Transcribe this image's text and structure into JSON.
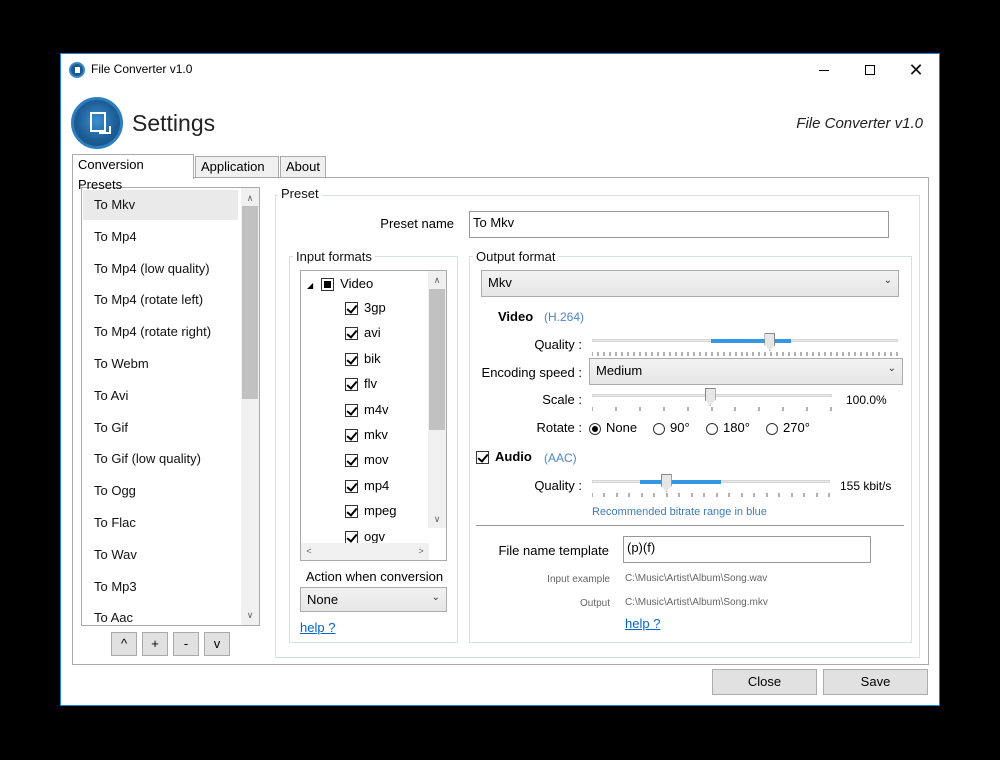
{
  "window": {
    "title": "File Converter v1.0",
    "header_title": "Settings",
    "header_right": "File Converter v1.0"
  },
  "titlebar_buttons": {
    "close_glyph": "✕"
  },
  "tabs": [
    {
      "label": "Conversion Presets",
      "active": true
    },
    {
      "label": "Application",
      "active": false
    },
    {
      "label": "About",
      "active": false
    }
  ],
  "presets": {
    "items": [
      "To Mkv",
      "To Mp4",
      "To Mp4 (low quality)",
      "To Mp4 (rotate left)",
      "To Mp4 (rotate right)",
      "To Webm",
      "To Avi",
      "To Gif",
      "To Gif (low quality)",
      "To Ogg",
      "To Flac",
      "To Wav",
      "To Mp3",
      "To Aac"
    ],
    "selected_index": 0,
    "scroll_fraction": 0.0,
    "buttons": {
      "up": "^",
      "add": "+",
      "remove": "-",
      "down": "v"
    }
  },
  "preset": {
    "group_label": "Preset",
    "name_label": "Preset name",
    "name_value": "To Mkv"
  },
  "input_formats": {
    "group_label": "Input formats",
    "tree_root": "Video",
    "tree_expander": "◢",
    "formats": [
      {
        "name": "3gp",
        "checked": true
      },
      {
        "name": "avi",
        "checked": true
      },
      {
        "name": "bik",
        "checked": true
      },
      {
        "name": "flv",
        "checked": true
      },
      {
        "name": "m4v",
        "checked": true
      },
      {
        "name": "mkv",
        "checked": true
      },
      {
        "name": "mov",
        "checked": true
      },
      {
        "name": "mp4",
        "checked": true
      },
      {
        "name": "mpeg",
        "checked": true
      },
      {
        "name": "ogv",
        "checked": true
      }
    ],
    "action_label": "Action when conversion",
    "action_value": "None",
    "help_link": "help ?"
  },
  "output": {
    "group_label": "Output format",
    "format_value": "Mkv",
    "video": {
      "label": "Video",
      "codec": "(H.264)",
      "quality_label": "Quality :",
      "quality_fraction": 0.58,
      "quality_recommended_range": [
        0.39,
        0.65
      ],
      "encoding_label": "Encoding speed :",
      "encoding_value": "Medium",
      "scale_label": "Scale :",
      "scale_value": "100.0%",
      "scale_fraction": 0.49,
      "rotate_label": "Rotate :",
      "rotate_options": [
        "None",
        "90°",
        "180°",
        "270°"
      ],
      "rotate_selected": 0
    },
    "audio": {
      "enabled": true,
      "label": "Audio",
      "codec": "(AAC)",
      "quality_label": "Quality :",
      "quality_value": "155 kbit/s",
      "quality_fraction": 0.31,
      "recommended_range": [
        0.2,
        0.54
      ],
      "recommended_note": "Recommended bitrate range in blue"
    },
    "file_name": {
      "label": "File name template",
      "value": "(p)(f)",
      "input_example_label": "Input example",
      "input_example_value": "C:\\Music\\Artist\\Album\\Song.wav",
      "output_label": "Output",
      "output_value": "C:\\Music\\Artist\\Album\\Song.mkv",
      "help_link": "help ?"
    }
  },
  "footer": {
    "close": "Close",
    "save": "Save"
  },
  "colors": {
    "accent": "#3397e3",
    "link": "#0066cc",
    "window_border": "#1883d7",
    "logo": "#1e5f98"
  }
}
